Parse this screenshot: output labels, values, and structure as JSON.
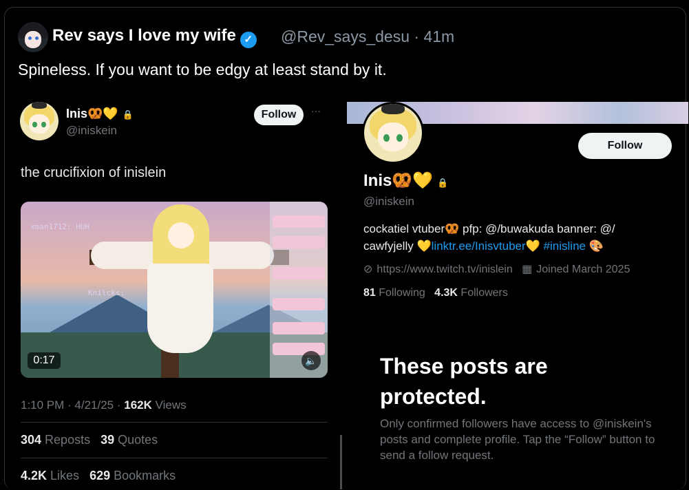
{
  "quote_tweet": {
    "author_name": "Rev says I love my wife",
    "handle_time": "@Rev_says_desu · 41m",
    "text": "Spineless. If you want to be edgy at least stand by it."
  },
  "quoted_tweet": {
    "name": "Inis🥨💛",
    "handle": "@iniskein",
    "follow_label": "Follow",
    "more_label": "···",
    "text": "the crucifixion of inislein",
    "video": {
      "duration": "0:17",
      "overlay_chat_1": "xman1712: HUH",
      "overlay_chat_2": "Knilcks:"
    },
    "meta": {
      "time": "1:10 PM · 4/21/25 · ",
      "views_count": "162K",
      "views_label": " Views"
    },
    "stats": {
      "reposts_count": "304",
      "reposts_label": " Reposts",
      "quotes_count": "39",
      "quotes_label": " Quotes",
      "likes_count": "4.2K",
      "likes_label": " Likes",
      "bookmarks_count": "629",
      "bookmarks_label": " Bookmarks"
    }
  },
  "profile": {
    "name": "Inis🥨💛",
    "handle": "@iniskein",
    "follow_label": "Follow",
    "bio_part1": "cockatiel vtuber🥨 pfp: @/buwakuda banner: @/ cawfyjelly 💛",
    "bio_link": "linktr.ee/Inisvtuber",
    "bio_part2": "💛 ",
    "bio_hashtag": "#inisline",
    "bio_end": " 🎨",
    "website": "https://www.twitch.tv/inislein",
    "joined": "Joined March 2025",
    "following_count": "81",
    "following_label": " Following",
    "followers_count": "4.3K",
    "followers_label": " Followers",
    "protected_title": "These posts are protected.",
    "protected_desc": "Only confirmed followers have access to @iniskein's posts and complete profile. Tap the “Follow” button to send a follow request."
  },
  "icons": {
    "verified": "check-badge-icon",
    "lock": "lock-icon",
    "link": "link-icon",
    "calendar": "calendar-icon",
    "mute": "mute-icon"
  },
  "colors": {
    "accent": "#1d9bf0",
    "background": "#000000",
    "muted_text": "#71767b"
  }
}
